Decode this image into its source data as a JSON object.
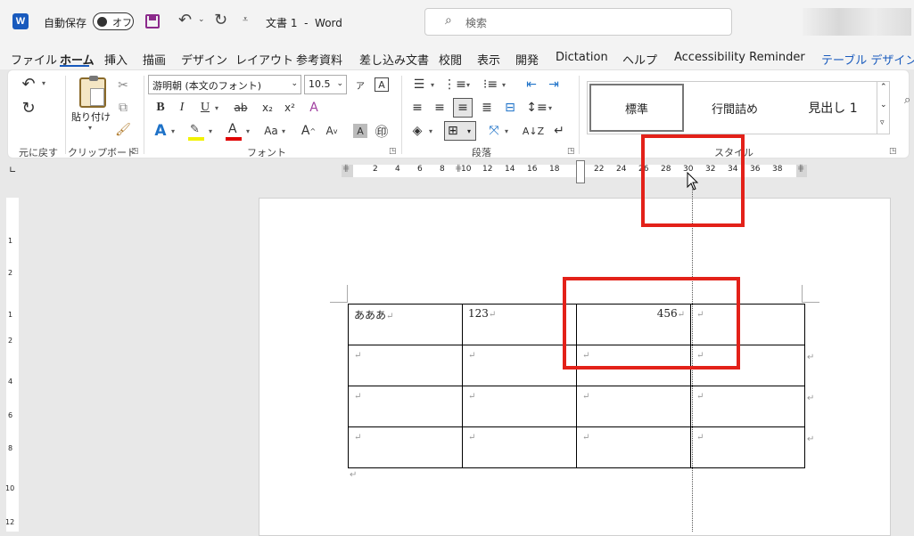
{
  "titlebar": {
    "autosave_label": "自動保存",
    "autosave_toggle": "オフ",
    "doc_title": "文書 1  -  Word",
    "search_placeholder": "検索"
  },
  "menu_tabs": [
    "ファイル",
    "ホーム",
    "挿入",
    "描画",
    "デザイン",
    "レイアウト",
    "参考資料",
    "差し込み文書",
    "校閲",
    "表示",
    "開発",
    "Dictation",
    "ヘルプ",
    "Accessibility Reminder",
    "テーブル デザイン"
  ],
  "ribbon": {
    "undo_group_label": "元に戻す",
    "clipboard": {
      "paste_label": "貼り付け",
      "group_label": "クリップボード"
    },
    "font": {
      "font_name": "游明朝 (本文のフォント)",
      "font_size": "10.5",
      "group_label": "フォント"
    },
    "paragraph": {
      "group_label": "段落"
    },
    "styles": {
      "items": [
        "標準",
        "行間詰め",
        "見出し 1"
      ],
      "group_label": "スタイル"
    }
  },
  "ruler": {
    "top_ticks": [
      "2",
      "4",
      "6",
      "8",
      "10",
      "12",
      "14",
      "16",
      "18",
      "20",
      "22",
      "24",
      "26",
      "28",
      "30",
      "32",
      "34",
      "36",
      "38"
    ],
    "left_ticks": [
      "1",
      "2",
      "1",
      "2",
      "4",
      "6",
      "8",
      "10",
      "12"
    ]
  },
  "table": {
    "rows": [
      [
        "あああ",
        "123",
        "456",
        ""
      ],
      [
        "",
        "",
        "",
        ""
      ],
      [
        "",
        "",
        "",
        ""
      ],
      [
        "",
        "",
        "",
        ""
      ]
    ]
  },
  "colors": {
    "accent": "#185abd",
    "highlight": "#e32119",
    "ribbon_bg": "#ffffff",
    "window_bg": "#f3f3f3"
  }
}
